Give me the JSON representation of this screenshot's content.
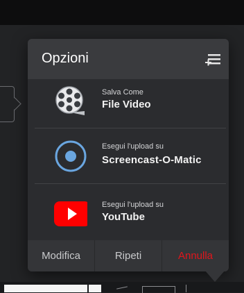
{
  "popup": {
    "title": "Opzioni",
    "menu_icon": "menu-add-icon",
    "options": [
      {
        "icon": "film-reel-icon",
        "small": "Salva Come",
        "big": "File Video"
      },
      {
        "icon": "screencast-o-matic-icon",
        "small": "Esegui l'upload su",
        "big": "Screencast-O-Matic"
      },
      {
        "icon": "youtube-icon",
        "small": "Esegui l'upload su",
        "big": "YouTube"
      }
    ],
    "footer": {
      "edit": "Modifica",
      "repeat": "Ripeti",
      "cancel": "Annulla"
    }
  },
  "colors": {
    "cancel": "#e0161c",
    "youtube_red": "#ff0000",
    "accent_blue": "#6aa6e0"
  }
}
